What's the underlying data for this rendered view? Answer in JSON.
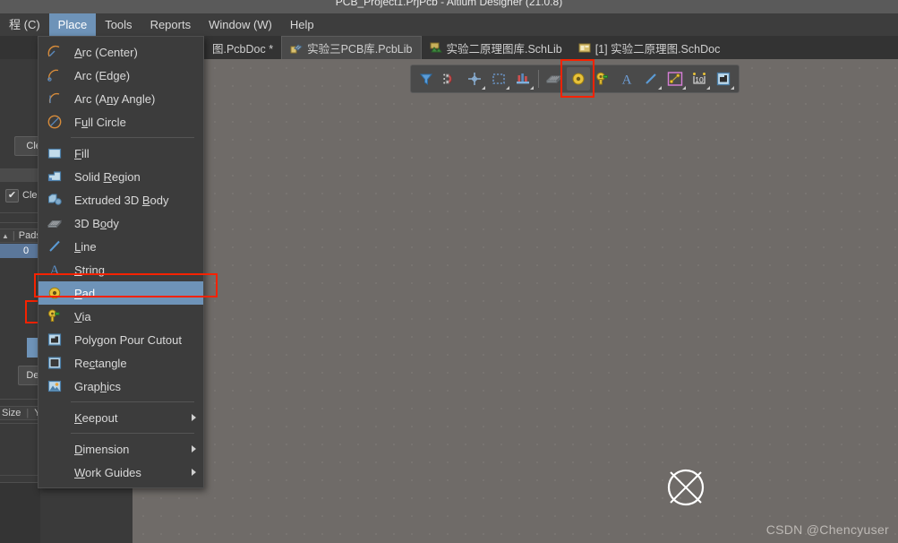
{
  "window": {
    "title": "PCB_Project1.PrjPcb - Altium Designer (21.0.8)"
  },
  "menubar": {
    "items": [
      {
        "label": "程 (C)",
        "accel": "C",
        "active": false
      },
      {
        "label": "Place",
        "accel": "P",
        "active": true
      },
      {
        "label": "Tools",
        "accel": "T",
        "active": false
      },
      {
        "label": "Reports",
        "accel": "R",
        "active": false
      },
      {
        "label": "Window (W)",
        "accel": "W",
        "active": false
      },
      {
        "label": "Help",
        "accel": "H",
        "active": false
      }
    ]
  },
  "tabstrip": {
    "tabs": [
      {
        "label": "图.PcbDoc *",
        "icon": "pcb-doc-icon",
        "selected": false
      },
      {
        "label": "实验三PCB库.PcbLib",
        "icon": "pcb-lib-icon",
        "selected": true
      },
      {
        "label": "实验二原理图库.SchLib",
        "icon": "sch-lib-icon",
        "selected": false
      },
      {
        "label": "[1] 实验二原理图.SchDoc",
        "icon": "sch-doc-icon",
        "selected": false
      }
    ]
  },
  "place_menu": {
    "title": "Place",
    "items": [
      {
        "label": "Arc (Center)",
        "accel": "A",
        "icon": "arc-center-icon",
        "type": "item"
      },
      {
        "label": "Arc (Edge)",
        "accel": "",
        "icon": "arc-edge-icon",
        "type": "item"
      },
      {
        "label": "Arc (Any Angle)",
        "accel": "n",
        "icon": "arc-any-icon",
        "type": "item"
      },
      {
        "label": "Full Circle",
        "accel": "u",
        "icon": "full-circle-icon",
        "type": "item"
      },
      {
        "type": "separator"
      },
      {
        "label": "Fill",
        "accel": "F",
        "icon": "fill-icon",
        "type": "item"
      },
      {
        "label": "Solid Region",
        "accel": "R",
        "icon": "solid-region-icon",
        "type": "item"
      },
      {
        "label": "Extruded 3D Body",
        "accel": "B",
        "icon": "extruded-3d-icon",
        "type": "item"
      },
      {
        "label": "3D Body",
        "accel": "o",
        "icon": "body-3d-icon",
        "type": "item"
      },
      {
        "label": "Line",
        "accel": "L",
        "icon": "line-icon",
        "type": "item"
      },
      {
        "label": "String",
        "accel": "S",
        "icon": "string-icon",
        "type": "item"
      },
      {
        "label": "Pad",
        "accel": "P",
        "icon": "pad-icon",
        "type": "item",
        "highlighted": true
      },
      {
        "label": "Via",
        "accel": "V",
        "icon": "via-icon",
        "type": "item"
      },
      {
        "label": "Polygon Pour Cutout",
        "accel": "g",
        "icon": "polygon-cutout-icon",
        "type": "item"
      },
      {
        "label": "Rectangle",
        "accel": "c",
        "icon": "rectangle-icon",
        "type": "item"
      },
      {
        "label": "Graphics",
        "accel": "h",
        "icon": "graphics-icon",
        "type": "item"
      },
      {
        "type": "separator"
      },
      {
        "label": "Keepout",
        "accel": "K",
        "icon": "",
        "type": "submenu"
      },
      {
        "type": "separator"
      },
      {
        "label": "Dimension",
        "accel": "D",
        "icon": "",
        "type": "submenu"
      },
      {
        "label": "Work Guides",
        "accel": "W",
        "icon": "",
        "type": "submenu"
      }
    ]
  },
  "toolbar": {
    "name": "PCB Lib Placement Toolbar",
    "buttons": [
      {
        "name": "filter-icon",
        "tooltip": "Filter",
        "dropdown": false,
        "selected": false
      },
      {
        "name": "magnet-icon",
        "tooltip": "Snap",
        "dropdown": false,
        "selected": false
      },
      {
        "name": "crosshair-icon",
        "tooltip": "Place Crosshair",
        "dropdown": true,
        "selected": false
      },
      {
        "name": "dashed-rect-icon",
        "tooltip": "Place Region",
        "dropdown": true,
        "selected": false
      },
      {
        "name": "component-icon",
        "tooltip": "Place Component",
        "dropdown": true,
        "selected": false
      },
      {
        "name": "separator",
        "tooltip": "",
        "dropdown": false,
        "selected": false
      },
      {
        "name": "layer-stack-icon",
        "tooltip": "Layer Stack",
        "dropdown": false,
        "selected": false
      },
      {
        "name": "pad-icon",
        "tooltip": "Place Pad",
        "dropdown": false,
        "selected": true
      },
      {
        "name": "via-icon",
        "tooltip": "Place Via",
        "dropdown": false,
        "selected": false
      },
      {
        "name": "string-icon",
        "tooltip": "Place String",
        "dropdown": false,
        "selected": false
      },
      {
        "name": "line-icon",
        "tooltip": "Place Line",
        "dropdown": true,
        "selected": false
      },
      {
        "name": "dimension-icon",
        "tooltip": "Place Dimension",
        "dropdown": true,
        "selected": false
      },
      {
        "name": "coordinate-icon",
        "tooltip": "Place Coordinate",
        "dropdown": true,
        "selected": false
      },
      {
        "name": "polygon-cutout-icon",
        "tooltip": "Polygon Pour Cutout",
        "dropdown": true,
        "selected": false
      }
    ],
    "highlight_color": "#f62200"
  },
  "left_panel": {
    "clear_button_label": "Clea",
    "clear_checkbox_label": "Cle",
    "pads_column_label": "Pads",
    "pads_value": "0",
    "delete_button_label": "Dele",
    "size_column_label": "Size",
    "y_column_label": "Y"
  },
  "canvas": {
    "cursor": "crosshair-circle-cursor",
    "watermark": "CSDN @Chencyuser",
    "background_color": "#6f6b68",
    "grid_dot_color": "#96928e"
  }
}
